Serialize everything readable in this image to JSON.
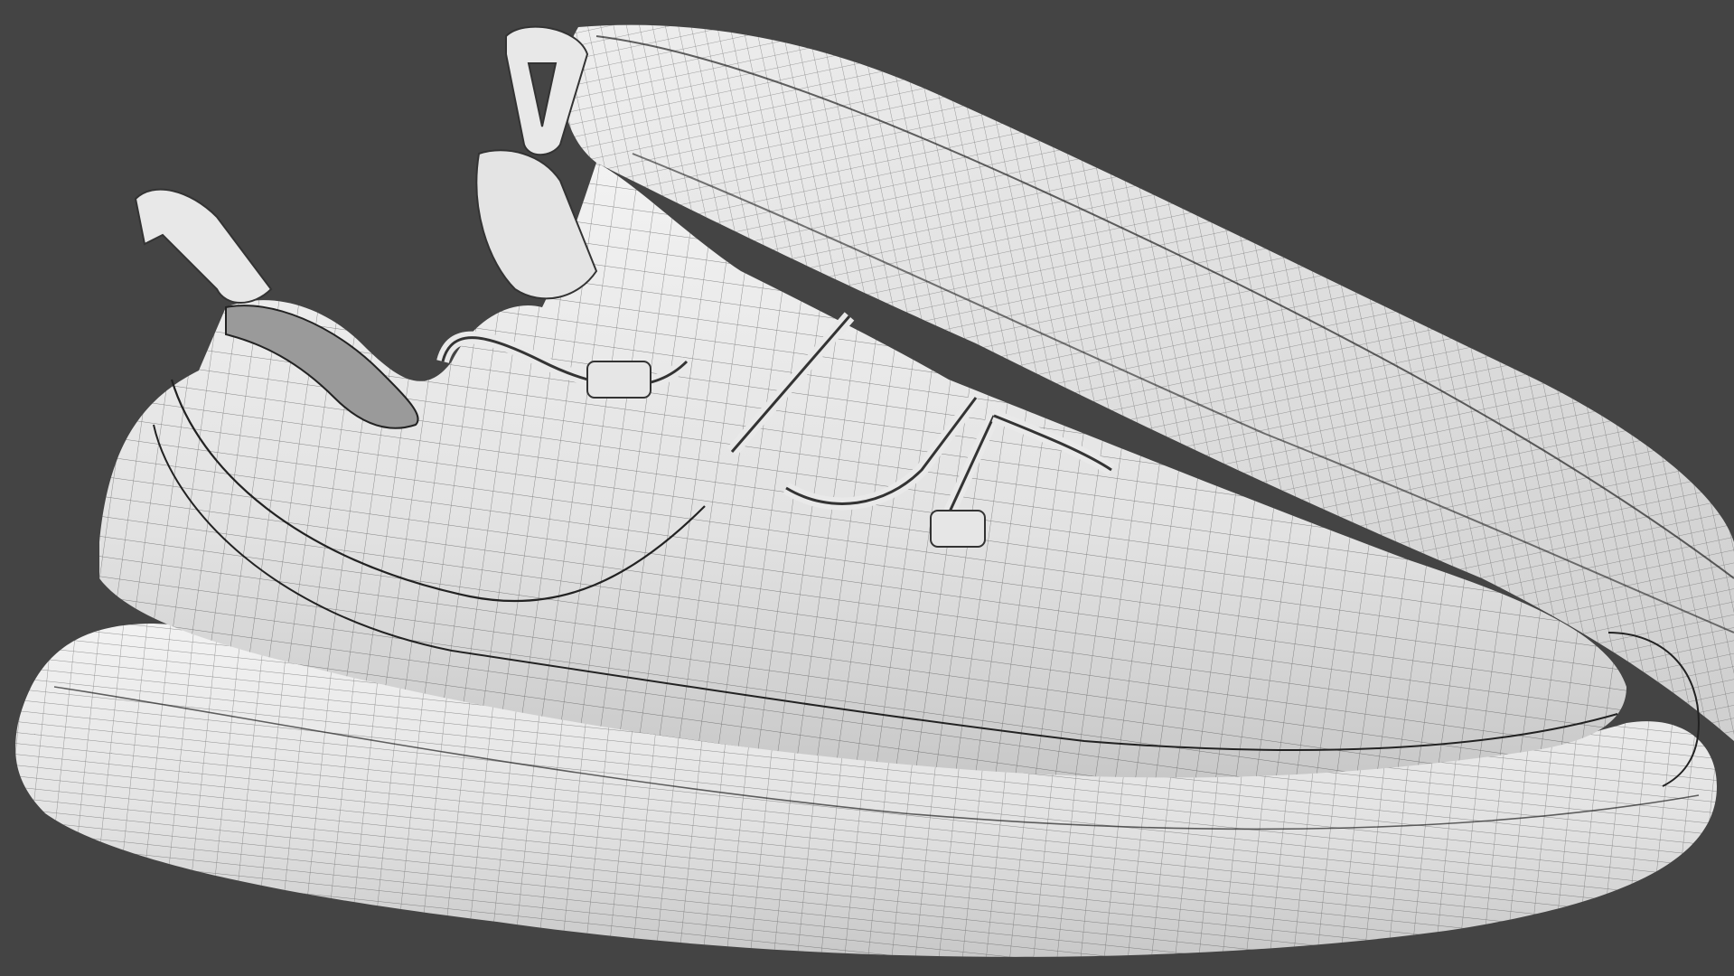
{
  "viewport": {
    "background_color": "#444444",
    "model_surface_color": "#e6e6e6",
    "model_shadow_color": "#bdbdbd",
    "wire_color": "#2a2a2a",
    "display_mode": "wireframe-on-shaded"
  },
  "scene": {
    "objects": [
      {
        "name": "shoe-rear",
        "kind": "sneaker"
      },
      {
        "name": "shoe-front",
        "kind": "sneaker"
      }
    ]
  }
}
